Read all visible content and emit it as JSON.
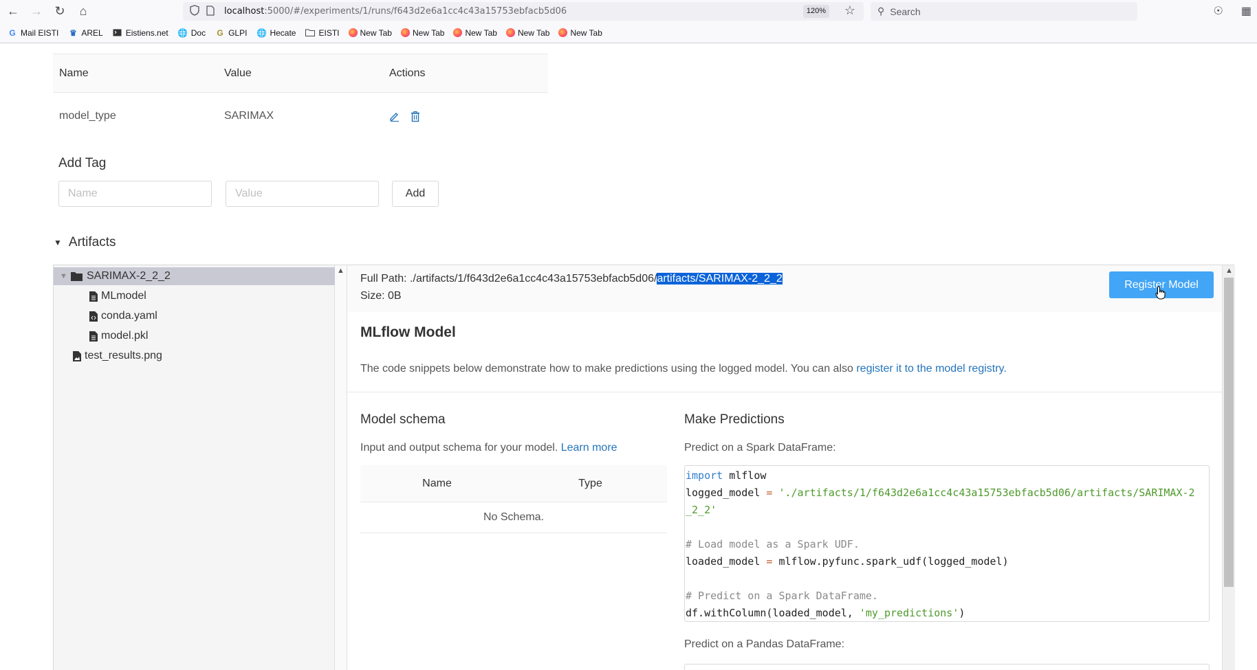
{
  "browser": {
    "url_host": "localhost",
    "url_rest": ":5000/#/experiments/1/runs/f643d2e6a1cc4c43a15753ebfacb5d06",
    "zoom": "120%",
    "search_placeholder": "Search"
  },
  "bookmarks": [
    {
      "label": "Mail EISTI",
      "icon": "google-icon"
    },
    {
      "label": "AREL",
      "icon": "arel-icon"
    },
    {
      "label": "Eistiens.net",
      "icon": "terminal-icon"
    },
    {
      "label": "Doc",
      "icon": "globe-icon"
    },
    {
      "label": "GLPI",
      "icon": "glpi-icon"
    },
    {
      "label": "Hecate",
      "icon": "globe-icon"
    },
    {
      "label": "EISTI",
      "icon": "folder-icon"
    },
    {
      "label": "New Tab",
      "icon": "firefox-icon"
    },
    {
      "label": "New Tab",
      "icon": "firefox-icon"
    },
    {
      "label": "New Tab",
      "icon": "firefox-icon"
    },
    {
      "label": "New Tab",
      "icon": "firefox-icon"
    },
    {
      "label": "New Tab",
      "icon": "firefox-icon"
    }
  ],
  "tags_table": {
    "headers": {
      "name": "Name",
      "value": "Value",
      "actions": "Actions"
    },
    "rows": [
      {
        "name": "model_type",
        "value": "SARIMAX"
      }
    ]
  },
  "add_tag": {
    "title": "Add Tag",
    "name_placeholder": "Name",
    "value_placeholder": "Value",
    "add_label": "Add"
  },
  "artifacts": {
    "title": "Artifacts",
    "tree": {
      "folder": "SARIMAX-2_2_2",
      "children": [
        "MLmodel",
        "conda.yaml",
        "model.pkl"
      ],
      "root_file": "test_results.png"
    }
  },
  "viewer": {
    "full_path_label": "Full Path:",
    "full_path_plain": "./artifacts/1/f643d2e6a1cc4c43a15753ebfacb5d06/",
    "full_path_selected": "artifacts/SARIMAX-2_2_2",
    "size_label": "Size:",
    "size_value": "0B",
    "register_label": "Register Model",
    "model_title": "MLflow Model",
    "intro_text": "The code snippets below demonstrate how to make predictions using the logged model. You can also ",
    "intro_link": "register it to the model registry.",
    "schema_title": "Model schema",
    "schema_desc": "Input and output schema for your model. ",
    "schema_link": "Learn more",
    "schema_headers": {
      "name": "Name",
      "type": "Type"
    },
    "schema_empty": "No Schema.",
    "predictions_title": "Make Predictions",
    "predict_spark_label": "Predict on a Spark DataFrame:",
    "predict_pandas_label": "Predict on a Pandas DataFrame:",
    "code": {
      "l1_kw": "import",
      "l1_rest": " mlflow",
      "l2_var": "logged_model ",
      "l2_eq": "=",
      "l2_str": " './artifacts/1/f643d2e6a1cc4c43a15753ebfacb5d06/artifacts/SARIMAX-2",
      "l3_str": "_2_2'",
      "l5_cm": "# Load model as a Spark UDF.",
      "l6_var": "loaded_model ",
      "l6_eq": "=",
      "l6_rest": " mlflow.pyfunc.spark_udf(logged_model)",
      "l8_cm": "# Predict on a Spark DataFrame.",
      "l9_pre": "df.withColumn(loaded_model, ",
      "l9_str": "'my_predictions'",
      "l9_post": ")"
    }
  }
}
